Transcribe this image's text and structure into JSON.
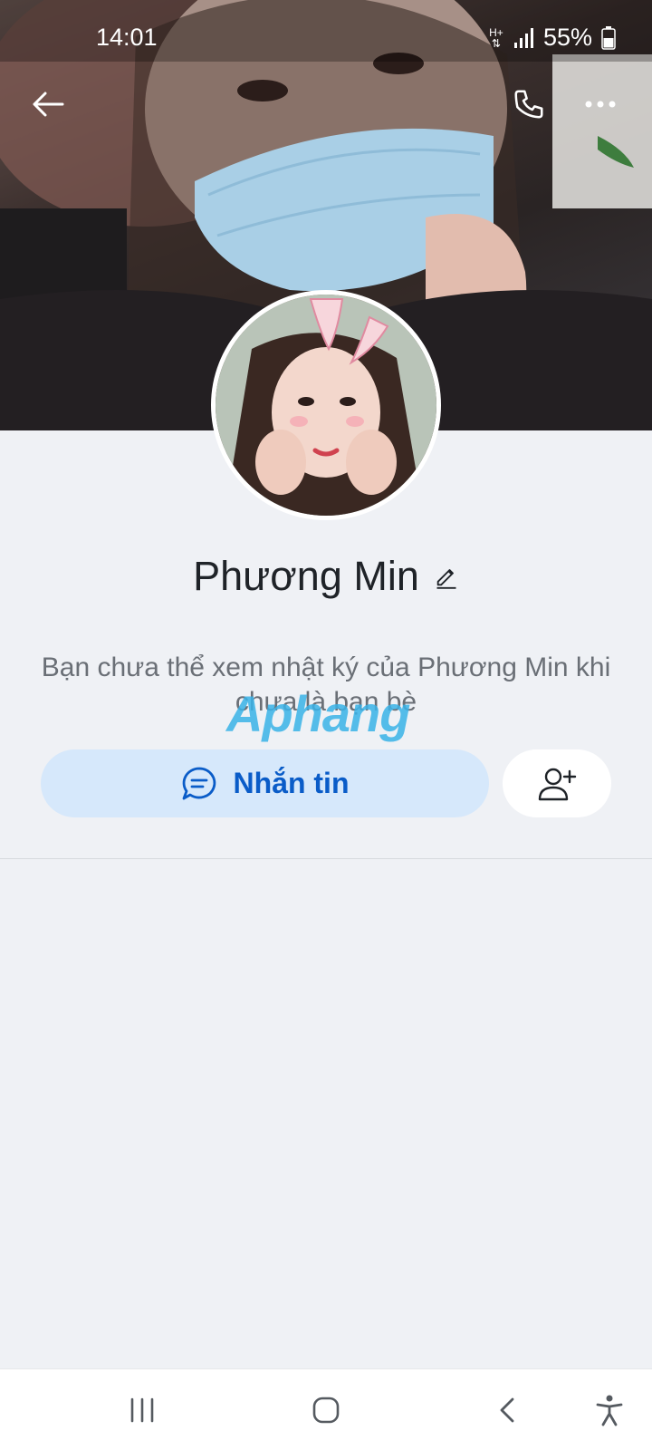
{
  "status_bar": {
    "time": "14:01",
    "network": "H+",
    "battery": "55%"
  },
  "profile": {
    "name": "Phương Min",
    "notice": "Bạn chưa thể xem nhật ký của Phương Min khi chưa là bạn bè"
  },
  "actions": {
    "message_label": "Nhắn tin"
  },
  "watermark": {
    "text": "Aphang"
  },
  "colors": {
    "accent": "#0a5cc8",
    "message_button_bg": "#d6e8fb",
    "background": "#eff1f5"
  },
  "icons": {
    "back": "arrow-left-icon",
    "call": "phone-icon",
    "more": "more-dots-icon",
    "edit": "pencil-icon",
    "message": "chat-bubble-icon",
    "add_friend": "add-friend-icon",
    "recents": "recents-icon",
    "home": "home-icon",
    "sys_back": "chevron-left-icon",
    "accessibility": "accessibility-icon"
  }
}
